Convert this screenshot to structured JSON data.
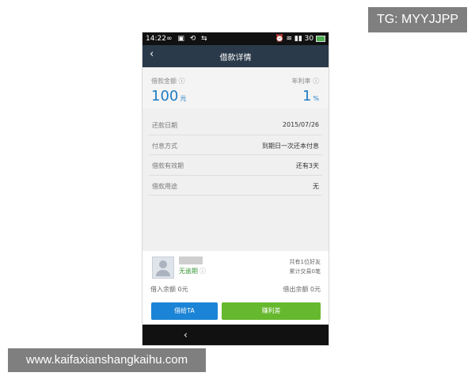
{
  "watermark_top": "TG: MYYJJPP",
  "watermark_bottom": "www.kaifaxianshangkaihu.com",
  "status_bar": {
    "time": "14:22",
    "left_icons": "∞ ▣ ⟲ ⇆",
    "right_icons": "⏰ ≋ ▮▮ 30",
    "battery_color": "#4caf50"
  },
  "navbar": {
    "back_glyph": "‹",
    "title": "借款详情"
  },
  "summary": {
    "amount_label": "借款金额",
    "amount_value": "100",
    "amount_unit": "元",
    "rate_label": "年利率",
    "rate_value": "1",
    "rate_unit": "%"
  },
  "details": [
    {
      "key": "还款日期",
      "value": "2015/07/26"
    },
    {
      "key": "付息方式",
      "value": "到期日一次还本付息"
    },
    {
      "key": "借款有效期",
      "value": "还有3天"
    },
    {
      "key": "借款用途",
      "value": "无"
    }
  ],
  "borrower": {
    "status": "无逾期",
    "friends": "共有1位好友",
    "trades": "累计交易0笔",
    "borrow_balance": "借入余额 0元",
    "lend_balance": "借出余额 0元"
  },
  "buttons": {
    "lend": "借给TA",
    "earn": "赚利差"
  },
  "colors": {
    "accent_blue": "#1f7bc2",
    "button_blue": "#1c84d6",
    "button_green": "#66b82e",
    "navbar": "#2b3a4a"
  }
}
